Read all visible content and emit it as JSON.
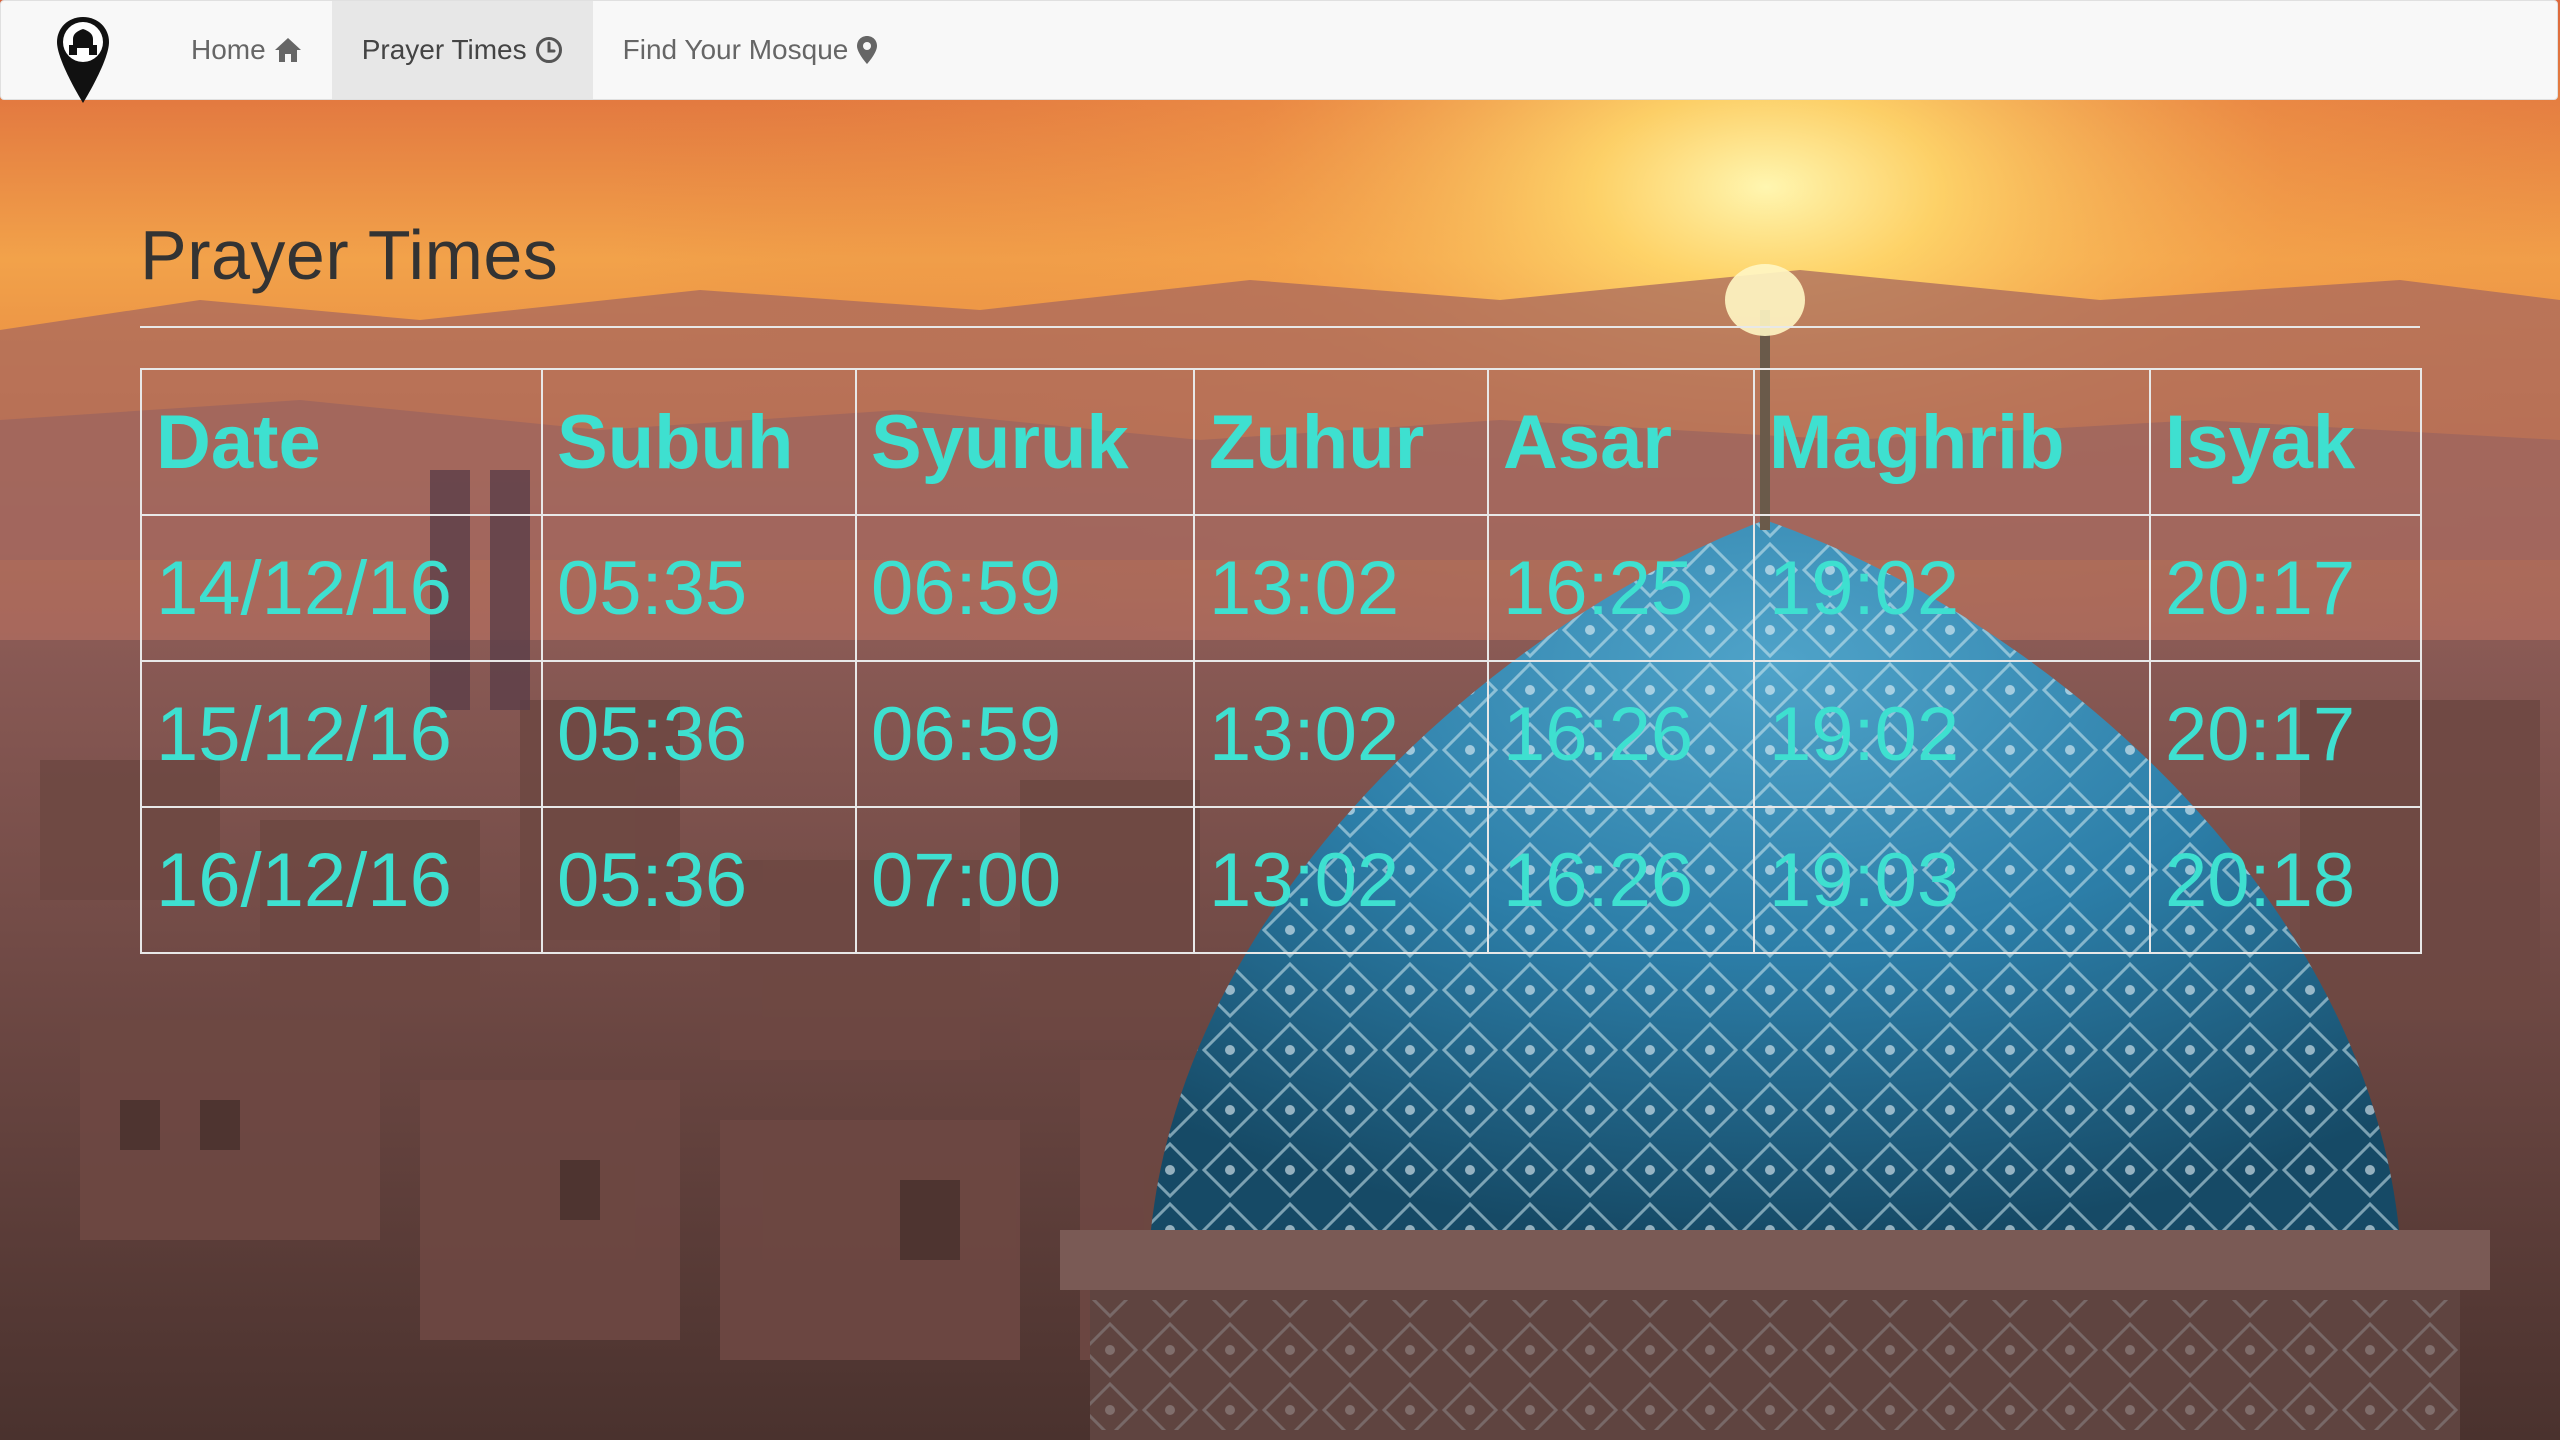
{
  "nav": {
    "brand_icon": "mosque-pin-icon",
    "items": [
      {
        "label": "Home",
        "icon": "home-icon",
        "active": false
      },
      {
        "label": "Prayer Times",
        "icon": "clock-icon",
        "active": true
      },
      {
        "label": "Find Your Mosque",
        "icon": "map-marker-icon",
        "active": false
      }
    ]
  },
  "main": {
    "title": "Prayer Times",
    "table": {
      "headers": [
        "Date",
        "Subuh",
        "Syuruk",
        "Zuhur",
        "Asar",
        "Maghrib",
        "Isyak"
      ],
      "rows": [
        [
          "14/12/16",
          "05:35",
          "06:59",
          "13:02",
          "16:25",
          "19:02",
          "20:17"
        ],
        [
          "15/12/16",
          "05:36",
          "06:59",
          "13:02",
          "16:26",
          "19:02",
          "20:17"
        ],
        [
          "16/12/16",
          "05:36",
          "07:00",
          "13:02",
          "16:26",
          "19:03",
          "20:18"
        ]
      ]
    }
  },
  "colors": {
    "accent": "#3ee0d0",
    "title": "#333333",
    "navbar_bg": "#f8f8f8",
    "nav_active_bg": "#e7e7e7"
  }
}
